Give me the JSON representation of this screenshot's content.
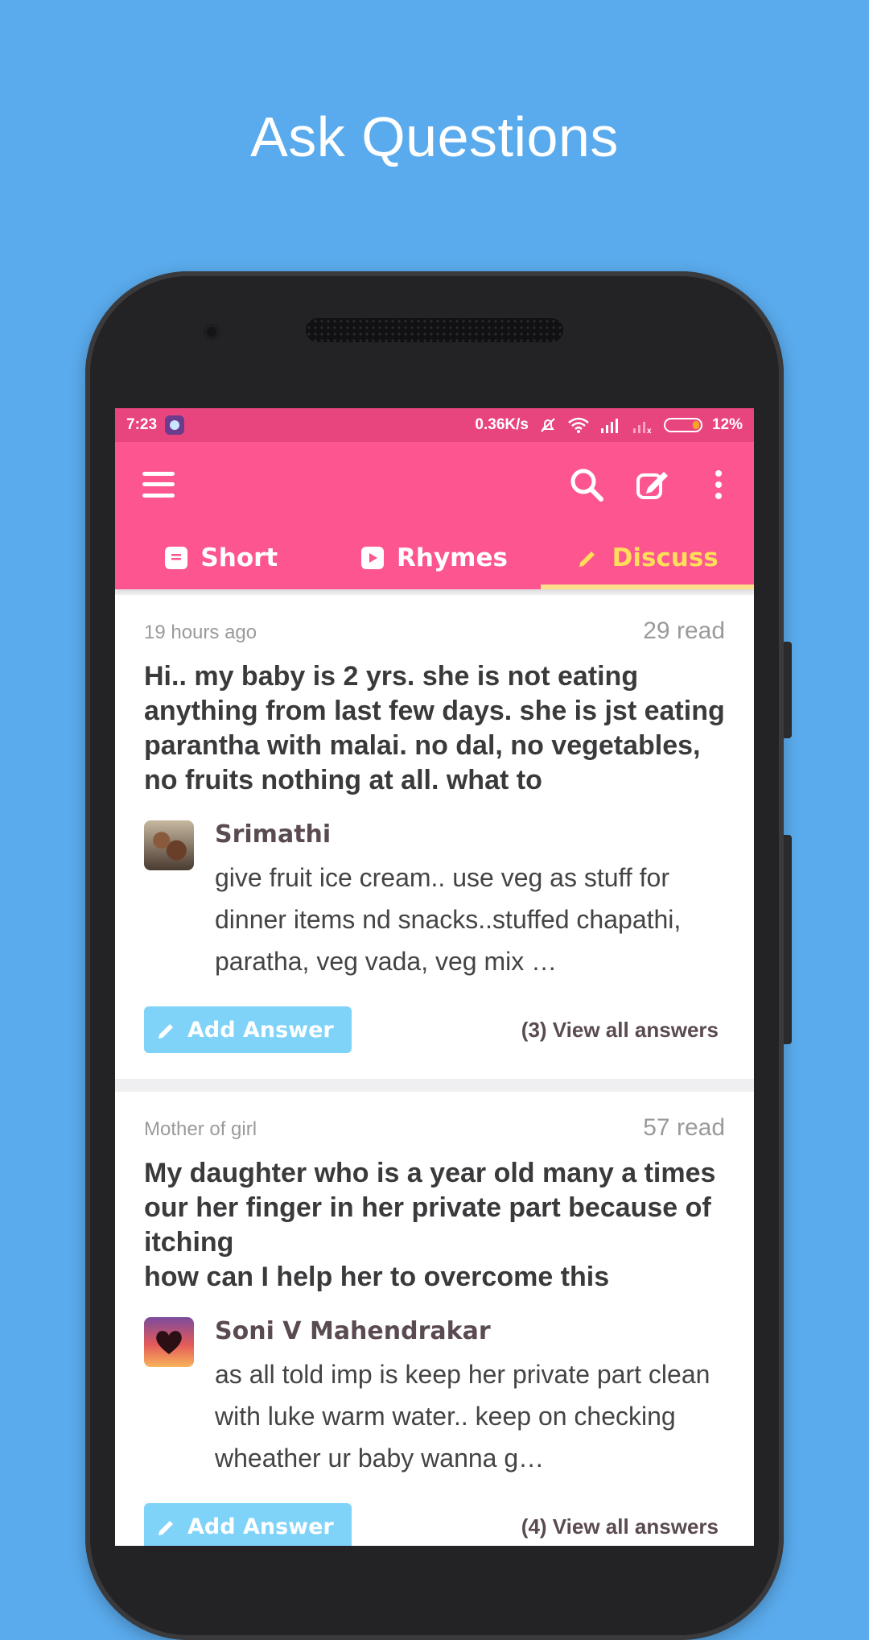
{
  "promo": {
    "title": "Ask Questions"
  },
  "status_bar": {
    "time": "7:23",
    "net_speed": "0.36K/s",
    "battery": "12%"
  },
  "colors": {
    "background": "#5aabed",
    "toolbar": "#fc5590",
    "status_bar": "#e8457e",
    "active_tab": "#ffde59",
    "add_answer": "#7fd3f8"
  },
  "toolbar": {
    "icons": [
      "menu-icon",
      "search-icon",
      "compose-icon",
      "more-icon"
    ]
  },
  "tabs": [
    {
      "label": "Short",
      "icon": "article-icon",
      "active": false
    },
    {
      "label": "Rhymes",
      "icon": "play-icon",
      "active": false
    },
    {
      "label": "Discuss",
      "icon": "pencil-icon",
      "active": true
    }
  ],
  "posts": [
    {
      "meta": "19 hours ago",
      "reads": "29 read",
      "question": "Hi.. my baby is 2 yrs. she is not eating anything from last few days. she is jst eating parantha with malai. no dal, no vegetables, no fruits nothing at all. what to",
      "answer": {
        "author": "Srimathi",
        "text": "give fruit ice cream.. use veg as stuff for dinner items nd snacks..stuffed chapathi, paratha, veg vada, veg mix …"
      },
      "add_answer_label": "Add Answer",
      "view_all_label": "(3) View all answers"
    },
    {
      "meta": "Mother of  girl",
      "reads": "57 read",
      "question": "My daughter who is a year old many a times our her finger in her private part because of itching\nhow can I help her to overcome this",
      "answer": {
        "author": "Soni V Mahendrakar",
        "text": "as all told imp is keep her private part clean with luke warm water.. keep on checking wheather ur baby wanna g…"
      },
      "add_answer_label": "Add Answer",
      "view_all_label": "(4) View all answers"
    }
  ]
}
